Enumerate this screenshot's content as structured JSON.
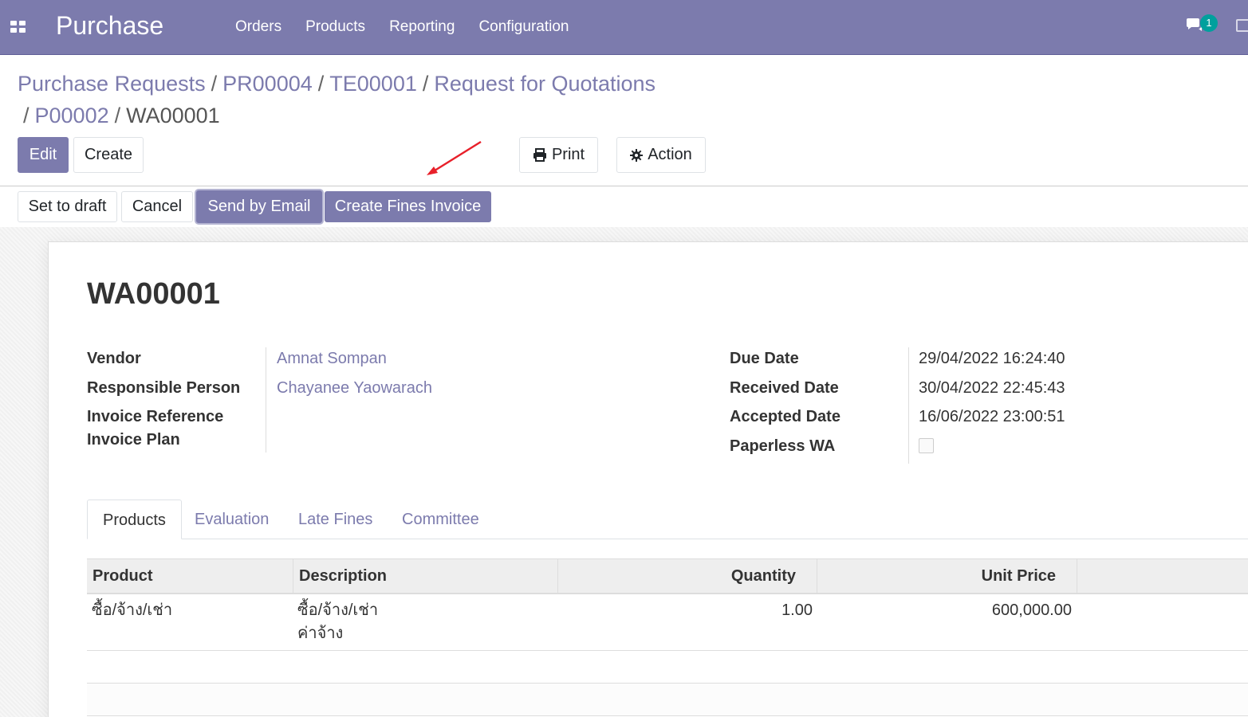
{
  "navbar": {
    "brand": "Purchase",
    "menu": [
      "Orders",
      "Products",
      "Reporting",
      "Configuration"
    ],
    "chat_count": "1"
  },
  "breadcrumb": {
    "items": [
      "Purchase Requests",
      "PR00004",
      "TE00001",
      "Request for Quotations",
      "P00002"
    ],
    "current": "WA00001",
    "separator": "/"
  },
  "toolbar": {
    "edit_label": "Edit",
    "create_label": "Create",
    "print_label": "Print",
    "action_label": "Action"
  },
  "statusbar": {
    "set_to_draft": "Set to draft",
    "cancel": "Cancel",
    "send_by_email": "Send by Email",
    "create_fines_invoice": "Create Fines Invoice"
  },
  "record": {
    "title": "WA00001",
    "left_fields": {
      "vendor_label": "Vendor",
      "vendor_value": "Amnat Sompan",
      "responsible_label": "Responsible Person",
      "responsible_value": "Chayanee Yaowarach",
      "invoice_ref_label": "Invoice Reference",
      "invoice_plan_label": "Invoice Plan"
    },
    "right_fields": {
      "due_date_label": "Due Date",
      "due_date_value": "29/04/2022 16:24:40",
      "received_date_label": "Received Date",
      "received_date_value": "30/04/2022 22:45:43",
      "accepted_date_label": "Accepted Date",
      "accepted_date_value": "16/06/2022 23:00:51",
      "paperless_label": "Paperless WA",
      "paperless_checked": false
    }
  },
  "tabs": [
    "Products",
    "Evaluation",
    "Late Fines",
    "Committee"
  ],
  "table": {
    "columns": [
      "Product",
      "Description",
      "Quantity",
      "Unit Price"
    ],
    "rows": [
      {
        "product": "ซื้อ/จ้าง/เช่า",
        "description_line1": "ซื้อ/จ้าง/เช่า",
        "description_line2": "ค่าจ้าง",
        "quantity": "1.00",
        "unit_price": "600,000.00"
      }
    ]
  },
  "colors": {
    "brand": "#7c7bad",
    "annotation_arrow": "#e8202a"
  }
}
